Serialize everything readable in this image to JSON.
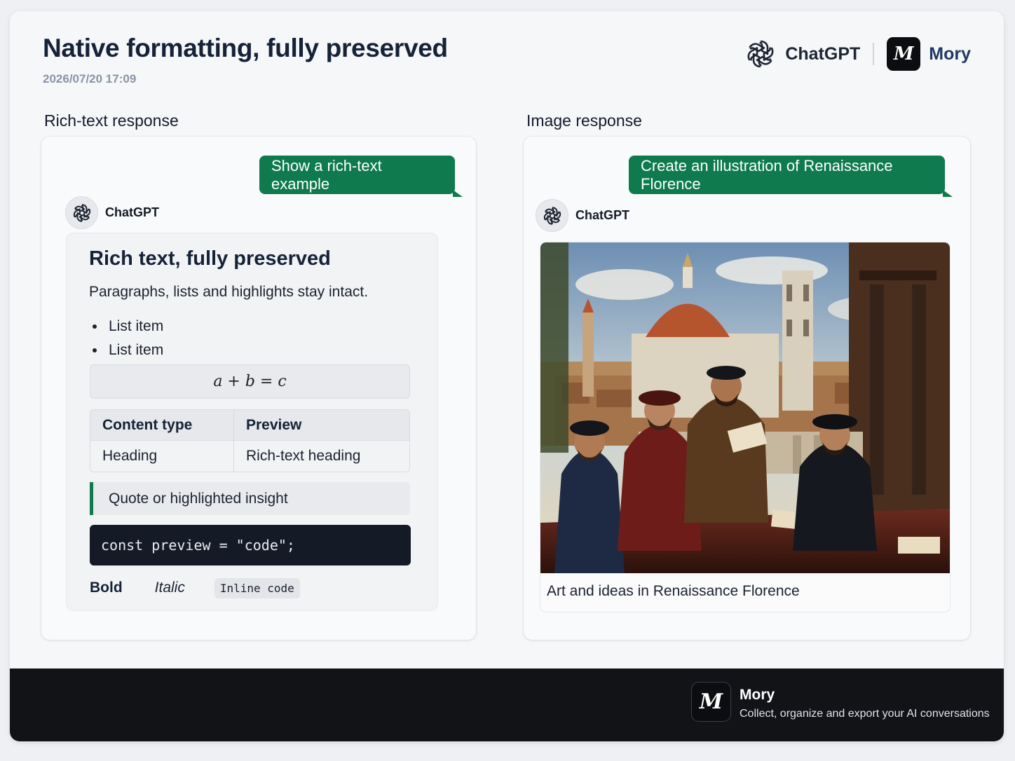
{
  "header": {
    "title": "Native formatting, fully preserved",
    "timestamp": "2026/07/20 17:09",
    "brand_left": "ChatGPT",
    "brand_right": "Mory",
    "brand_left_icon": "openai-logo-icon",
    "brand_right_icon": "mory-logo-icon"
  },
  "left": {
    "section_title": "Rich-text response",
    "user_message": "Show a rich-text example",
    "assistant_name": "ChatGPT",
    "rich": {
      "heading": "Rich text, fully preserved",
      "paragraph": "Paragraphs, lists and highlights stay intact.",
      "list": [
        "List item",
        "List item"
      ],
      "math": "a + b = c",
      "table": {
        "headers": [
          "Content type",
          "Preview"
        ],
        "rows": [
          [
            "Heading",
            "Rich-text heading"
          ]
        ]
      },
      "quote": "Quote or highlighted insight",
      "code": "const preview = \"code\";",
      "bold": "Bold",
      "italic": "Italic",
      "inline_code": "Inline code"
    }
  },
  "right": {
    "section_title": "Image response",
    "user_message": "Create an illustration of Renaissance Florence",
    "assistant_name": "ChatGPT",
    "caption": "Art and ideas in Renaissance Florence"
  },
  "footer": {
    "name": "Mory",
    "tagline": "Collect, organize and export your AI conversations"
  },
  "colors": {
    "accent_green": "#0e7a4e",
    "footer_bg": "#111317",
    "title_navy": "#152238"
  }
}
